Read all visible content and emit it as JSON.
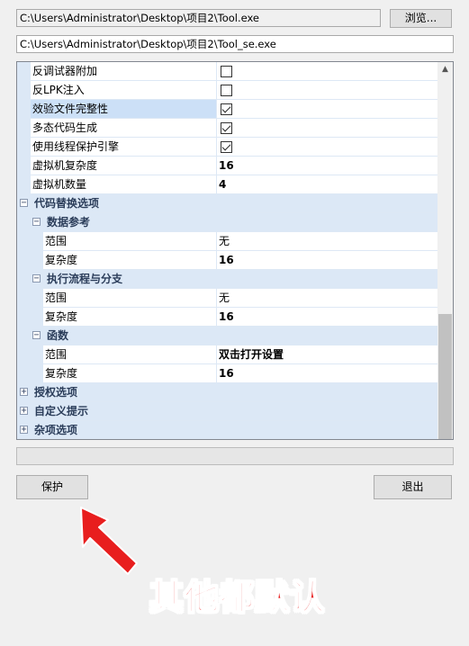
{
  "paths": {
    "input_path": "C:\\Users\\Administrator\\Desktop\\项目2\\Tool.exe",
    "output_path": "C:\\Users\\Administrator\\Desktop\\项目2\\Tool_se.exe"
  },
  "buttons": {
    "browse": "浏览...",
    "protect": "保护",
    "exit": "退出"
  },
  "grid": {
    "rows": [
      {
        "kind": "prop",
        "level": 1,
        "name": "反调试器附加",
        "value_type": "check",
        "checked": false
      },
      {
        "kind": "prop",
        "level": 1,
        "name": "反LPK注入",
        "value_type": "check",
        "checked": false
      },
      {
        "kind": "prop",
        "level": 1,
        "name": "效验文件完整性",
        "value_type": "check",
        "checked": true,
        "selected": true
      },
      {
        "kind": "prop",
        "level": 1,
        "name": "多态代码生成",
        "value_type": "check",
        "checked": true
      },
      {
        "kind": "prop",
        "level": 1,
        "name": "使用线程保护引擎",
        "value_type": "check",
        "checked": true
      },
      {
        "kind": "prop",
        "level": 1,
        "name": "虚拟机复杂度",
        "value_type": "text",
        "value": "16",
        "bold": true
      },
      {
        "kind": "prop",
        "level": 1,
        "name": "虚拟机数量",
        "value_type": "text",
        "value": "4",
        "bold": true
      },
      {
        "kind": "cat",
        "level": 0,
        "name": "代码替换选项",
        "expanded": true
      },
      {
        "kind": "cat",
        "level": 1,
        "name": "数据参考",
        "expanded": true
      },
      {
        "kind": "prop",
        "level": 2,
        "name": "范围",
        "value_type": "text",
        "value": "无",
        "bold": false
      },
      {
        "kind": "prop",
        "level": 2,
        "name": "复杂度",
        "value_type": "text",
        "value": "16",
        "bold": true
      },
      {
        "kind": "cat",
        "level": 1,
        "name": "执行流程与分支",
        "expanded": true
      },
      {
        "kind": "prop",
        "level": 2,
        "name": "范围",
        "value_type": "text",
        "value": "无",
        "bold": false
      },
      {
        "kind": "prop",
        "level": 2,
        "name": "复杂度",
        "value_type": "text",
        "value": "16",
        "bold": true
      },
      {
        "kind": "cat",
        "level": 1,
        "name": "函数",
        "expanded": true
      },
      {
        "kind": "prop",
        "level": 2,
        "name": "范围",
        "value_type": "text",
        "value": "双击打开设置",
        "bold": true
      },
      {
        "kind": "prop",
        "level": 2,
        "name": "复杂度",
        "value_type": "text",
        "value": "16",
        "bold": true
      },
      {
        "kind": "cat",
        "level": 0,
        "name": "授权选项",
        "expanded": false
      },
      {
        "kind": "cat",
        "level": 0,
        "name": "自定义提示",
        "expanded": false
      },
      {
        "kind": "cat",
        "level": 0,
        "name": "杂项选项",
        "expanded": false
      }
    ]
  },
  "progress": 0,
  "annotation": {
    "text": "其他都默认",
    "color": "#e81e1e"
  },
  "icons": {
    "scroll_up": "chevron-up-icon",
    "expand": "plus-box-icon",
    "collapse": "minus-box-icon",
    "checkbox": "checkbox-icon",
    "arrow": "red-arrow-icon"
  }
}
